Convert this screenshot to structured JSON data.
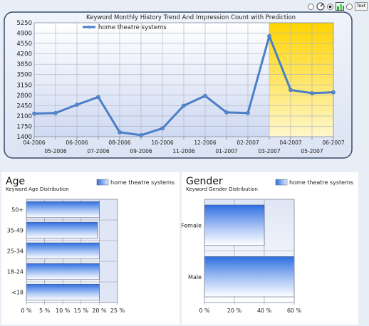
{
  "toolbar": {
    "text_label": "Text"
  },
  "chart_data": [
    {
      "type": "line",
      "title": "Keyword Monthly History Trend And Impression Count with Prediction",
      "legend": "top-left",
      "series": [
        {
          "name": "home theatre systems",
          "values": [
            2180,
            2200,
            2480,
            2740,
            1550,
            1450,
            1680,
            2450,
            2780,
            2220,
            2200,
            4800,
            2980,
            2870,
            2900
          ]
        }
      ],
      "categories": [
        "04-2006",
        "05-2006",
        "06-2006",
        "07-2006",
        "08-2006",
        "09-2006",
        "10-2006",
        "11-2006",
        "12-2006",
        "01-2007",
        "02-2007",
        "03-2007",
        "04-2007",
        "05-2007",
        "06-2007"
      ],
      "ylim": [
        1400,
        5250
      ],
      "yticks": [
        "5250",
        "4900",
        "4550",
        "4200",
        "3850",
        "3500",
        "3150",
        "2800",
        "2450",
        "2100",
        "1750",
        "1400"
      ],
      "prediction_from": "03-2007",
      "grid": true,
      "colors": {
        "line": "#4a7fc8",
        "prediction": "#ffd400"
      }
    },
    {
      "type": "bar",
      "orientation": "horizontal",
      "title": "Age",
      "subtitle": "Keyword Age Distribution",
      "legend": "top-right",
      "categories": [
        "50+",
        "35-49",
        "25-34",
        "18-24",
        "<18"
      ],
      "series": [
        {
          "name": "home theatre systems",
          "values": [
            20,
            19.5,
            20,
            20,
            20
          ]
        }
      ],
      "xlim": [
        0,
        25
      ],
      "xticks": [
        "0 %",
        "5 %",
        "10 %",
        "15 %",
        "20 %",
        "25 %"
      ],
      "highlight_range": [
        20,
        25
      ],
      "grid": true
    },
    {
      "type": "bar",
      "orientation": "horizontal",
      "title": "Gender",
      "subtitle": "Keyword Gender Distribution",
      "legend": "top-right",
      "categories": [
        "Female",
        "Male"
      ],
      "series": [
        {
          "name": "home theatre systems",
          "values": [
            40,
            60
          ]
        }
      ],
      "xlim": [
        0,
        60
      ],
      "xticks": [
        "0 %",
        "20 %",
        "40 %",
        "60 %"
      ],
      "grid": true
    }
  ]
}
